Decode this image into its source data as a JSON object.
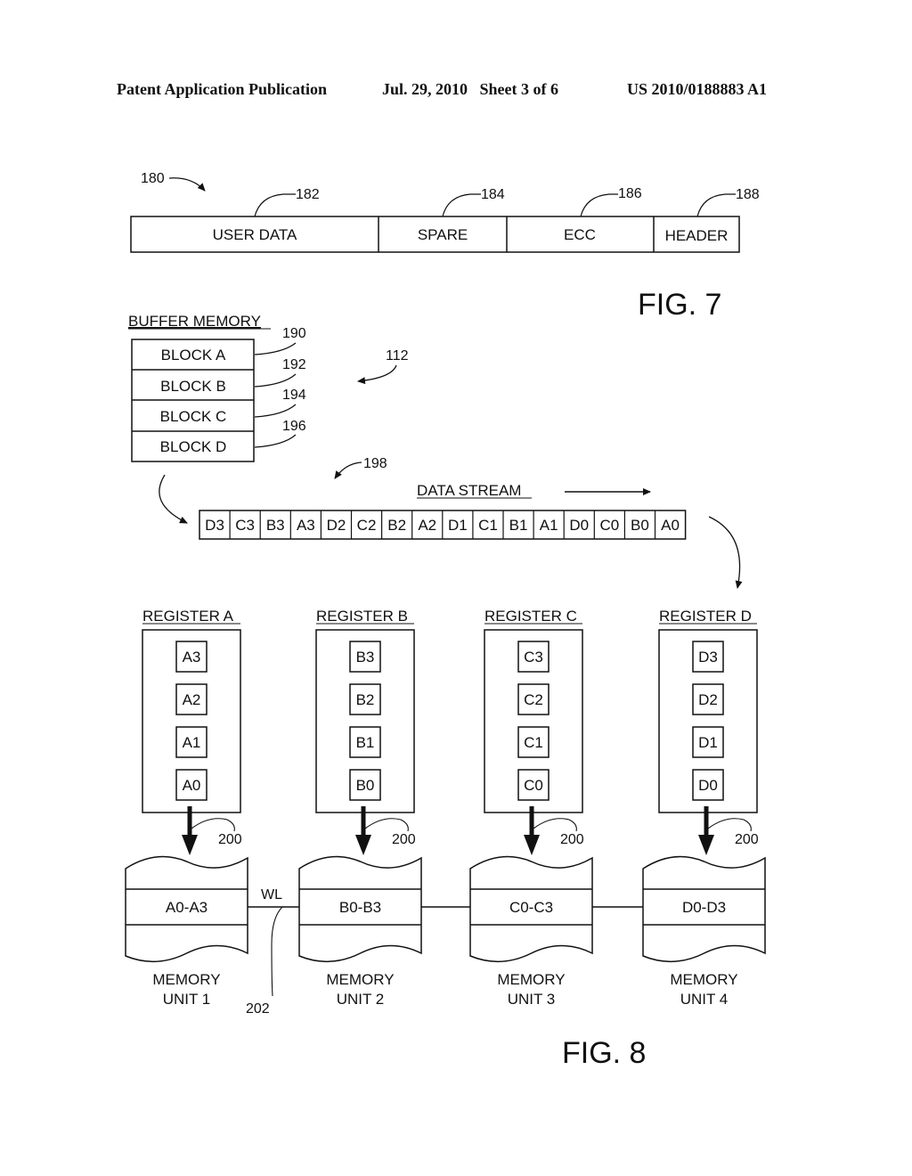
{
  "header": {
    "publication": "Patent Application Publication",
    "date_sheet": "Jul. 29, 2010   Sheet 3 of 6",
    "number": "US 2010/0188883 A1"
  },
  "fig7": {
    "label": "FIG. 7",
    "ref": "180",
    "fields": [
      {
        "label": "USER DATA",
        "ref": "182"
      },
      {
        "label": "SPARE",
        "ref": "184"
      },
      {
        "label": "ECC",
        "ref": "186"
      },
      {
        "label": "HEADER",
        "ref": "188"
      }
    ]
  },
  "fig8": {
    "label": "FIG. 8",
    "ref": "112",
    "buffer": {
      "title": "BUFFER MEMORY",
      "blocks": [
        {
          "label": "BLOCK A",
          "ref": "190"
        },
        {
          "label": "BLOCK B",
          "ref": "192"
        },
        {
          "label": "BLOCK C",
          "ref": "194"
        },
        {
          "label": "BLOCK D",
          "ref": "196"
        }
      ]
    },
    "stream": {
      "title": "DATA STREAM",
      "ref": "198",
      "cells": [
        "D3",
        "C3",
        "B3",
        "A3",
        "D2",
        "C2",
        "B2",
        "A2",
        "D1",
        "C1",
        "B1",
        "A1",
        "D0",
        "C0",
        "B0",
        "A0"
      ]
    },
    "registers": [
      {
        "title": "REGISTER A",
        "items": [
          "A3",
          "A2",
          "A1",
          "A0"
        ],
        "ref": "200"
      },
      {
        "title": "REGISTER B",
        "items": [
          "B3",
          "B2",
          "B1",
          "B0"
        ],
        "ref": "200"
      },
      {
        "title": "REGISTER C",
        "items": [
          "C3",
          "C2",
          "C1",
          "C0"
        ],
        "ref": "200"
      },
      {
        "title": "REGISTER D",
        "items": [
          "D3",
          "D2",
          "D1",
          "D0"
        ],
        "ref": "200"
      }
    ],
    "memory_units": [
      {
        "range": "A0-A3",
        "name_line1": "MEMORY",
        "name_line2": "UNIT 1"
      },
      {
        "range": "B0-B3",
        "name_line1": "MEMORY",
        "name_line2": "UNIT 2"
      },
      {
        "range": "C0-C3",
        "name_line1": "MEMORY",
        "name_line2": "UNIT 3"
      },
      {
        "range": "D0-D3",
        "name_line1": "MEMORY",
        "name_line2": "UNIT 4"
      }
    ],
    "wordline": {
      "label": "WL",
      "ref": "202"
    }
  }
}
